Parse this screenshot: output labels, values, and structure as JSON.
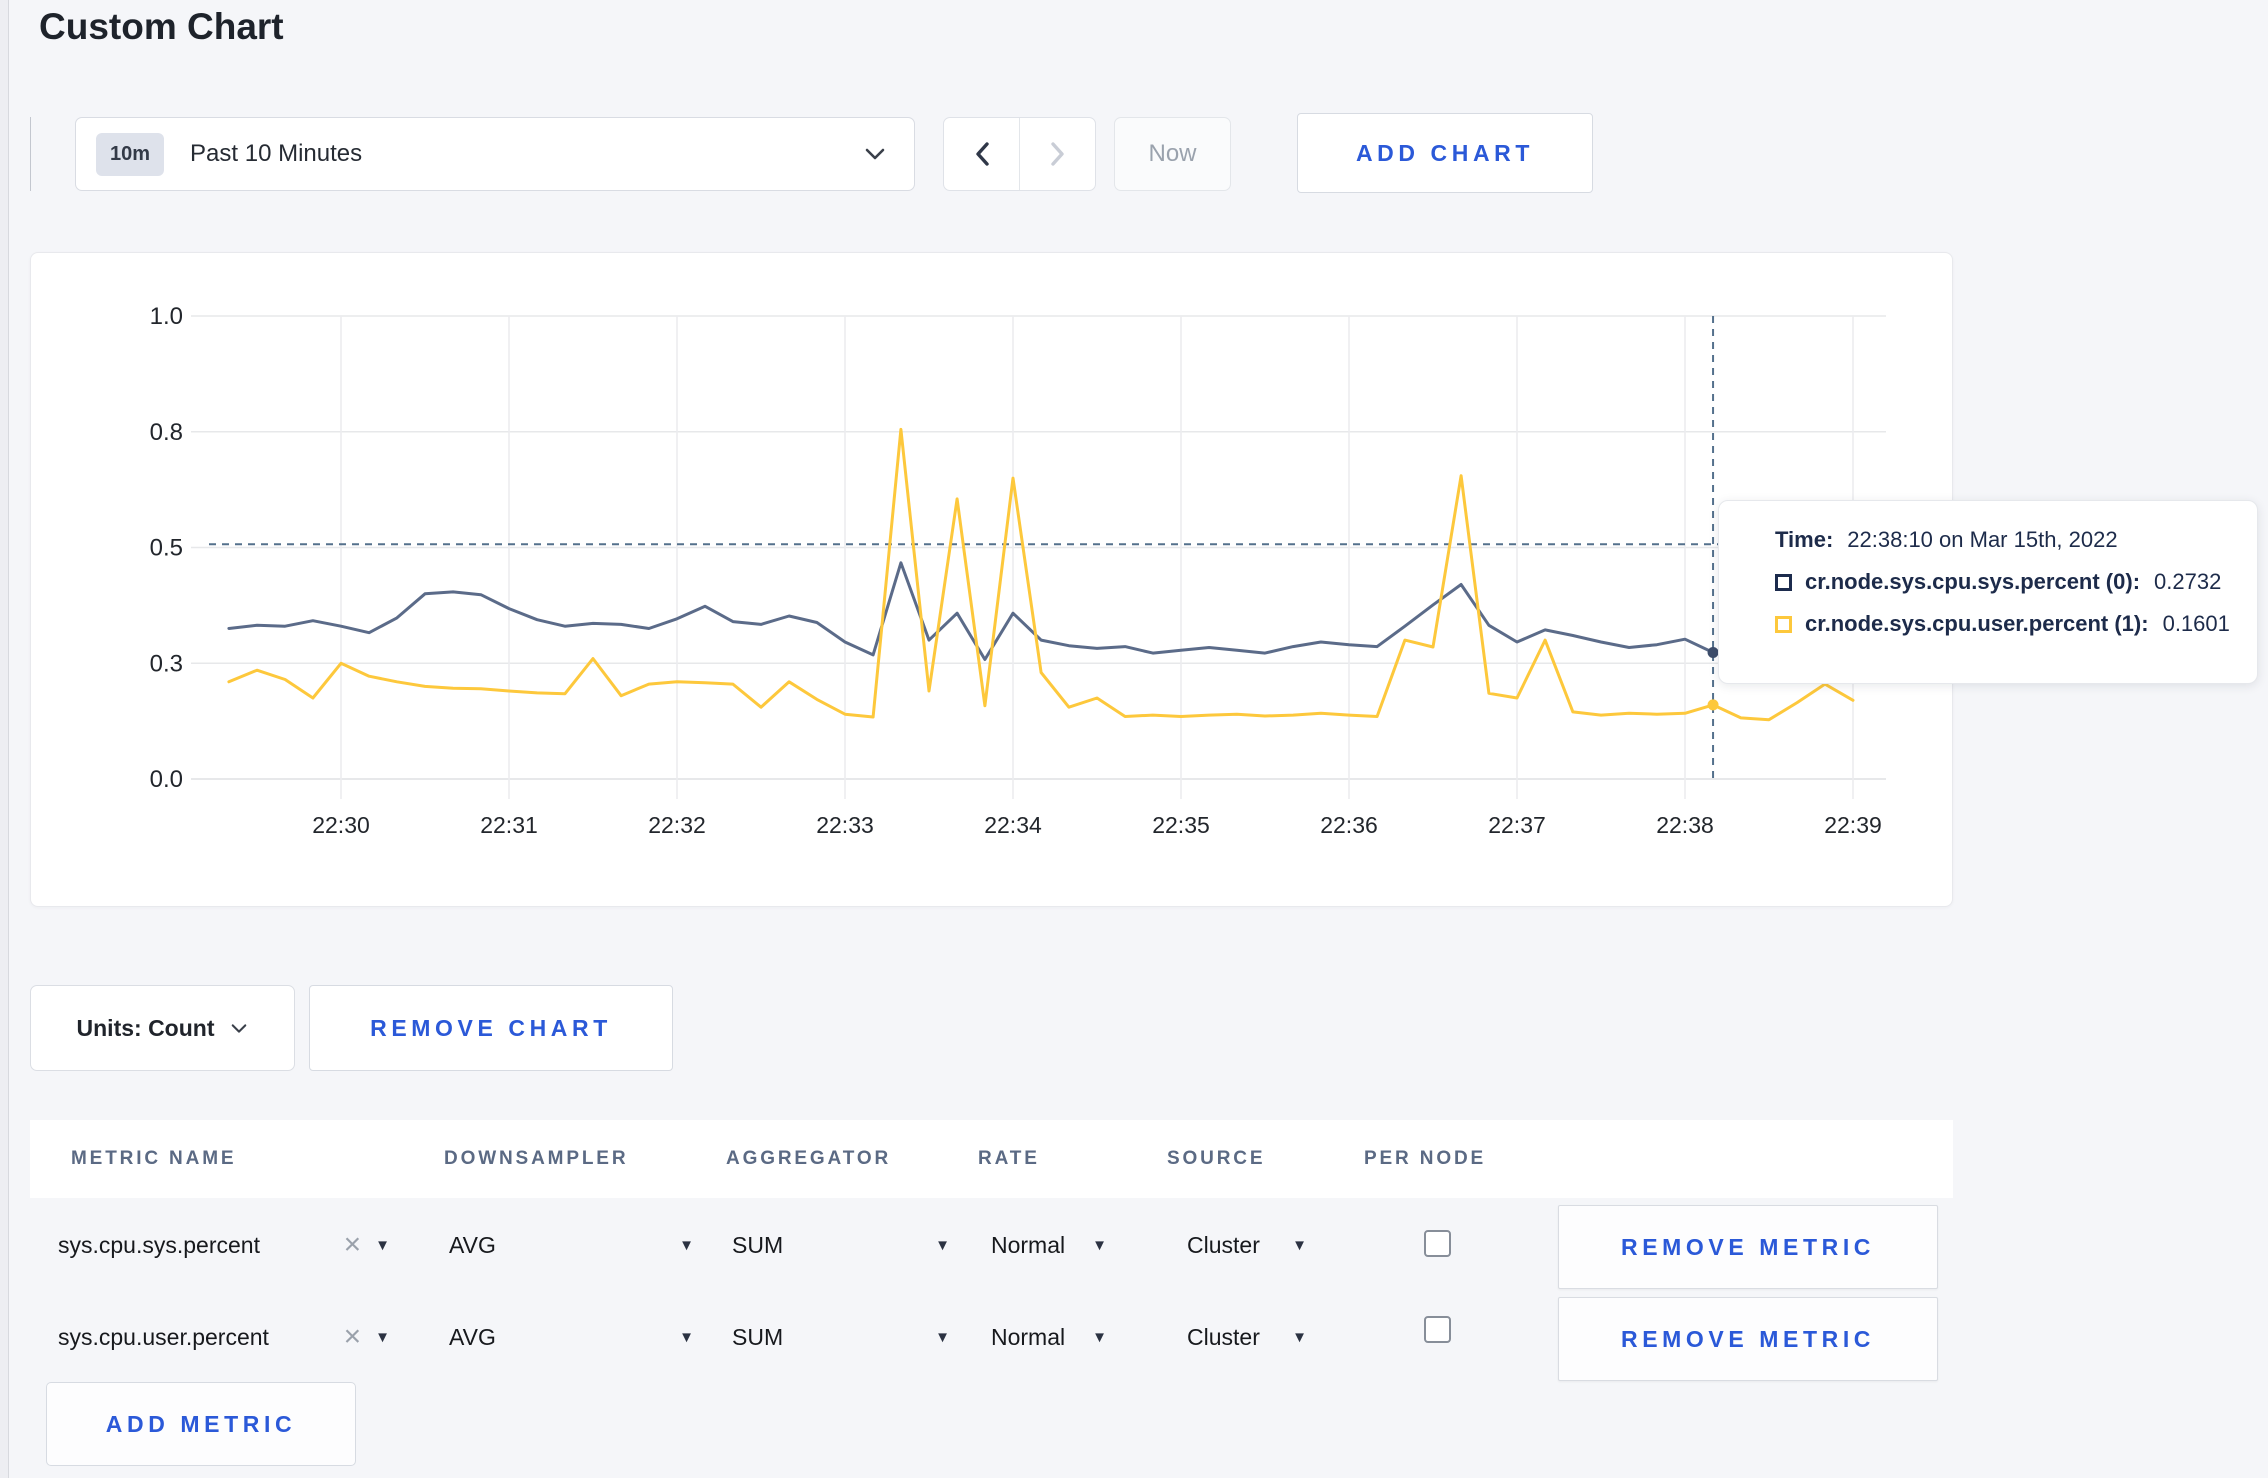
{
  "page": {
    "title": "Custom Chart",
    "background": "#f5f6f9",
    "accent_blue": "#2b59d8"
  },
  "toolbar": {
    "time_window": {
      "badge": "10m",
      "label": "Past 10 Minutes"
    },
    "now_label": "Now",
    "add_chart_label": "ADD CHART"
  },
  "chart": {
    "tooltip": {
      "time_label": "Time:",
      "time_value": "22:38:10 on Mar 15th, 2022",
      "series": [
        {
          "label": "cr.node.sys.cpu.sys.percent (0):",
          "value": "0.2732",
          "color": "#1c2b4d"
        },
        {
          "label": "cr.node.sys.cpu.user.percent (1):",
          "value": "0.1601",
          "color": "#fdc83c"
        }
      ]
    }
  },
  "chart_data": {
    "type": "line",
    "title": "",
    "xlabel": "time",
    "ylabel": "",
    "ylim": [
      0,
      1
    ],
    "grid": true,
    "legend_position": "tooltip",
    "y_ticks": [
      {
        "v": 0.0,
        "label": "0.0"
      },
      {
        "v": 0.25,
        "label": "0.3"
      },
      {
        "v": 0.5,
        "label": "0.5"
      },
      {
        "v": 0.75,
        "label": "0.8"
      },
      {
        "v": 1.0,
        "label": "1.0"
      }
    ],
    "x_ticks": [
      {
        "t": 0,
        "label": "22:30"
      },
      {
        "t": 1,
        "label": "22:31"
      },
      {
        "t": 2,
        "label": "22:32"
      },
      {
        "t": 3,
        "label": "22:33"
      },
      {
        "t": 4,
        "label": "22:34"
      },
      {
        "t": 5,
        "label": "22:35"
      },
      {
        "t": 6,
        "label": "22:36"
      },
      {
        "t": 7,
        "label": "22:37"
      },
      {
        "t": 8,
        "label": "22:38"
      },
      {
        "t": 9,
        "label": "22:39"
      }
    ],
    "x_unit": "minutes offset from 22:30",
    "x": [
      -0.667,
      -0.5,
      -0.333,
      -0.167,
      0,
      0.167,
      0.333,
      0.5,
      0.667,
      0.833,
      1,
      1.167,
      1.333,
      1.5,
      1.667,
      1.833,
      2,
      2.167,
      2.333,
      2.5,
      2.667,
      2.833,
      3,
      3.167,
      3.333,
      3.5,
      3.667,
      3.833,
      4,
      4.167,
      4.333,
      4.5,
      4.667,
      4.833,
      5,
      5.167,
      5.333,
      5.5,
      5.667,
      5.833,
      6,
      6.167,
      6.333,
      6.5,
      6.667,
      6.833,
      7,
      7.167,
      7.333,
      7.5,
      7.667,
      7.833,
      8,
      8.167,
      8.333,
      8.5,
      8.667,
      8.833,
      9
    ],
    "series": [
      {
        "name": "cr.node.sys.cpu.sys.percent",
        "color": "#5b6b89",
        "values": [
          0.325,
          0.332,
          0.33,
          0.342,
          0.33,
          0.316,
          0.348,
          0.4,
          0.404,
          0.398,
          0.368,
          0.344,
          0.33,
          0.336,
          0.334,
          0.325,
          0.346,
          0.373,
          0.34,
          0.334,
          0.352,
          0.338,
          0.296,
          0.268,
          0.467,
          0.3,
          0.358,
          0.258,
          0.358,
          0.3,
          0.288,
          0.282,
          0.286,
          0.272,
          0.278,
          0.284,
          0.278,
          0.272,
          0.286,
          0.296,
          0.29,
          0.286,
          0.33,
          0.376,
          0.42,
          0.332,
          0.296,
          0.322,
          0.31,
          0.296,
          0.284,
          0.29,
          0.302,
          0.2732,
          0.292,
          0.298,
          0.294,
          0.3,
          0.296
        ]
      },
      {
        "name": "cr.node.sys.cpu.user.percent",
        "color": "#fdc83c",
        "values": [
          0.21,
          0.235,
          0.215,
          0.175,
          0.25,
          0.222,
          0.21,
          0.2,
          0.196,
          0.195,
          0.19,
          0.186,
          0.184,
          0.26,
          0.18,
          0.205,
          0.21,
          0.208,
          0.205,
          0.155,
          0.21,
          0.172,
          0.14,
          0.134,
          0.755,
          0.19,
          0.605,
          0.158,
          0.65,
          0.23,
          0.155,
          0.175,
          0.135,
          0.138,
          0.135,
          0.138,
          0.14,
          0.136,
          0.138,
          0.142,
          0.138,
          0.135,
          0.3,
          0.285,
          0.655,
          0.185,
          0.175,
          0.3,
          0.145,
          0.138,
          0.142,
          0.14,
          0.142,
          0.1601,
          0.132,
          0.128,
          0.165,
          0.205,
          0.17
        ]
      }
    ],
    "crosshair": {
      "t": 8.167,
      "time": "22:38:10",
      "hline_value": 0.507,
      "points": [
        {
          "series": 0,
          "value": 0.2732
        },
        {
          "series": 1,
          "value": 0.1601
        }
      ]
    }
  },
  "units_row": {
    "units_label": "Units: Count",
    "remove_chart_label": "REMOVE CHART"
  },
  "table": {
    "headers": [
      "METRIC NAME",
      "DOWNSAMPLER",
      "AGGREGATOR",
      "RATE",
      "SOURCE",
      "PER NODE"
    ],
    "rows": [
      {
        "metric": "sys.cpu.sys.percent",
        "downsampler": "AVG",
        "aggregator": "SUM",
        "rate": "Normal",
        "source": "Cluster",
        "per_node_checked": false,
        "remove_label": "REMOVE METRIC"
      },
      {
        "metric": "sys.cpu.user.percent",
        "downsampler": "AVG",
        "aggregator": "SUM",
        "rate": "Normal",
        "source": "Cluster",
        "per_node_checked": false,
        "remove_label": "REMOVE METRIC"
      }
    ],
    "add_metric_label": "ADD METRIC"
  }
}
